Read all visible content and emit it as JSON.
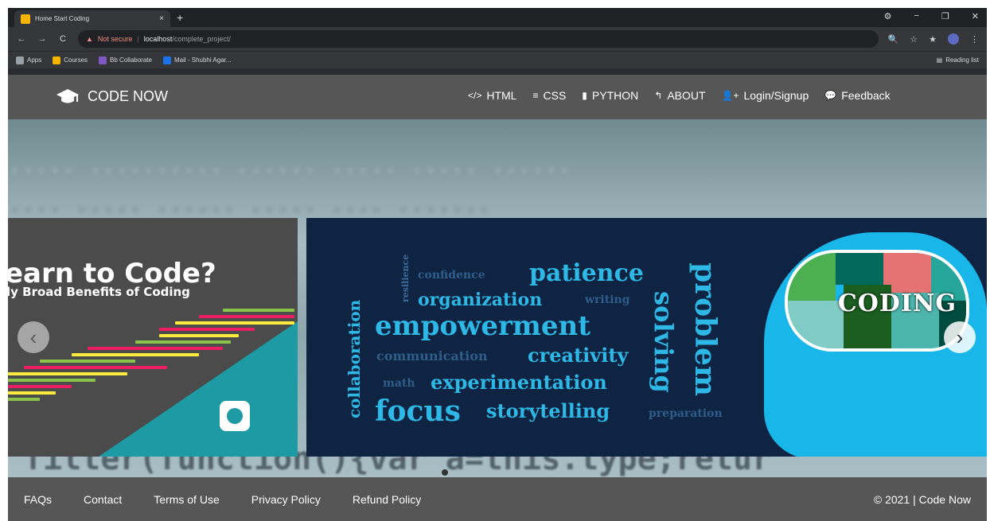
{
  "browser": {
    "tab_title": "Home Start Coding",
    "tab_close": "×",
    "new_tab": "+",
    "window_controls": [
      "⚙",
      "−",
      "❐",
      "✕"
    ],
    "nav": {
      "back": "←",
      "forward": "→",
      "reload": "C"
    },
    "security_label": "Not secure",
    "url_host": "localhost",
    "url_path": "/complete_project/",
    "toolbar_icons": [
      "🔍",
      "☆",
      "★",
      "⋮"
    ],
    "bookmarks": [
      {
        "label": "Apps",
        "color": "#9aa0a6"
      },
      {
        "label": "Courses",
        "color": "#f4b400"
      },
      {
        "label": "Bb Collaborate",
        "color": "#7e57c2"
      },
      {
        "label": "Mail - Shubhi Agar...",
        "color": "#1a73e8"
      }
    ],
    "reading_list": "Reading list"
  },
  "site": {
    "brand": "CODE NOW",
    "nav": [
      {
        "icon": "</>",
        "label": "HTML"
      },
      {
        "icon": "≡",
        "label": "CSS"
      },
      {
        "icon": "▮",
        "label": "PYTHON"
      },
      {
        "icon": "↰",
        "label": "ABOUT"
      },
      {
        "icon": "👤+",
        "label": "Login/Signup"
      },
      {
        "icon": "💬",
        "label": "Feedback"
      }
    ]
  },
  "hero": {
    "bg_code_bottom": "filter(function(){var a=this.type;retur",
    "left_slide": {
      "title": "earn to Code?",
      "subtitle": "ly Broad Benefits of Coding"
    },
    "word_cloud": {
      "resilience": "resilience",
      "confidence": "confidence",
      "patience": "patience",
      "organization": "organization",
      "writing": "writing",
      "empowerment": "empowerment",
      "communication": "communication",
      "creativity": "creativity",
      "math": "math",
      "experimentation": "experimentation",
      "focus": "focus",
      "storytelling": "storytelling",
      "preparation": "preparation",
      "collaboration": "collaboration",
      "solving": "solving",
      "problem": "problem",
      "coding": "CODING"
    },
    "prev_label": "‹",
    "next_label": "›",
    "slide_count": 3,
    "active_slide": 1
  },
  "footer": {
    "links": [
      "FAQs",
      "Contact",
      "Terms of Use",
      "Privacy Policy",
      "Refund Policy"
    ],
    "copyright": "© 2021 | Code Now"
  },
  "colors": {
    "nav_bg": "#565656",
    "teal": "#1d9aa3",
    "wordcloud_bg": "#0f2342",
    "word_cyan": "#2eb8e6",
    "boy_blue": "#19b6ea"
  }
}
